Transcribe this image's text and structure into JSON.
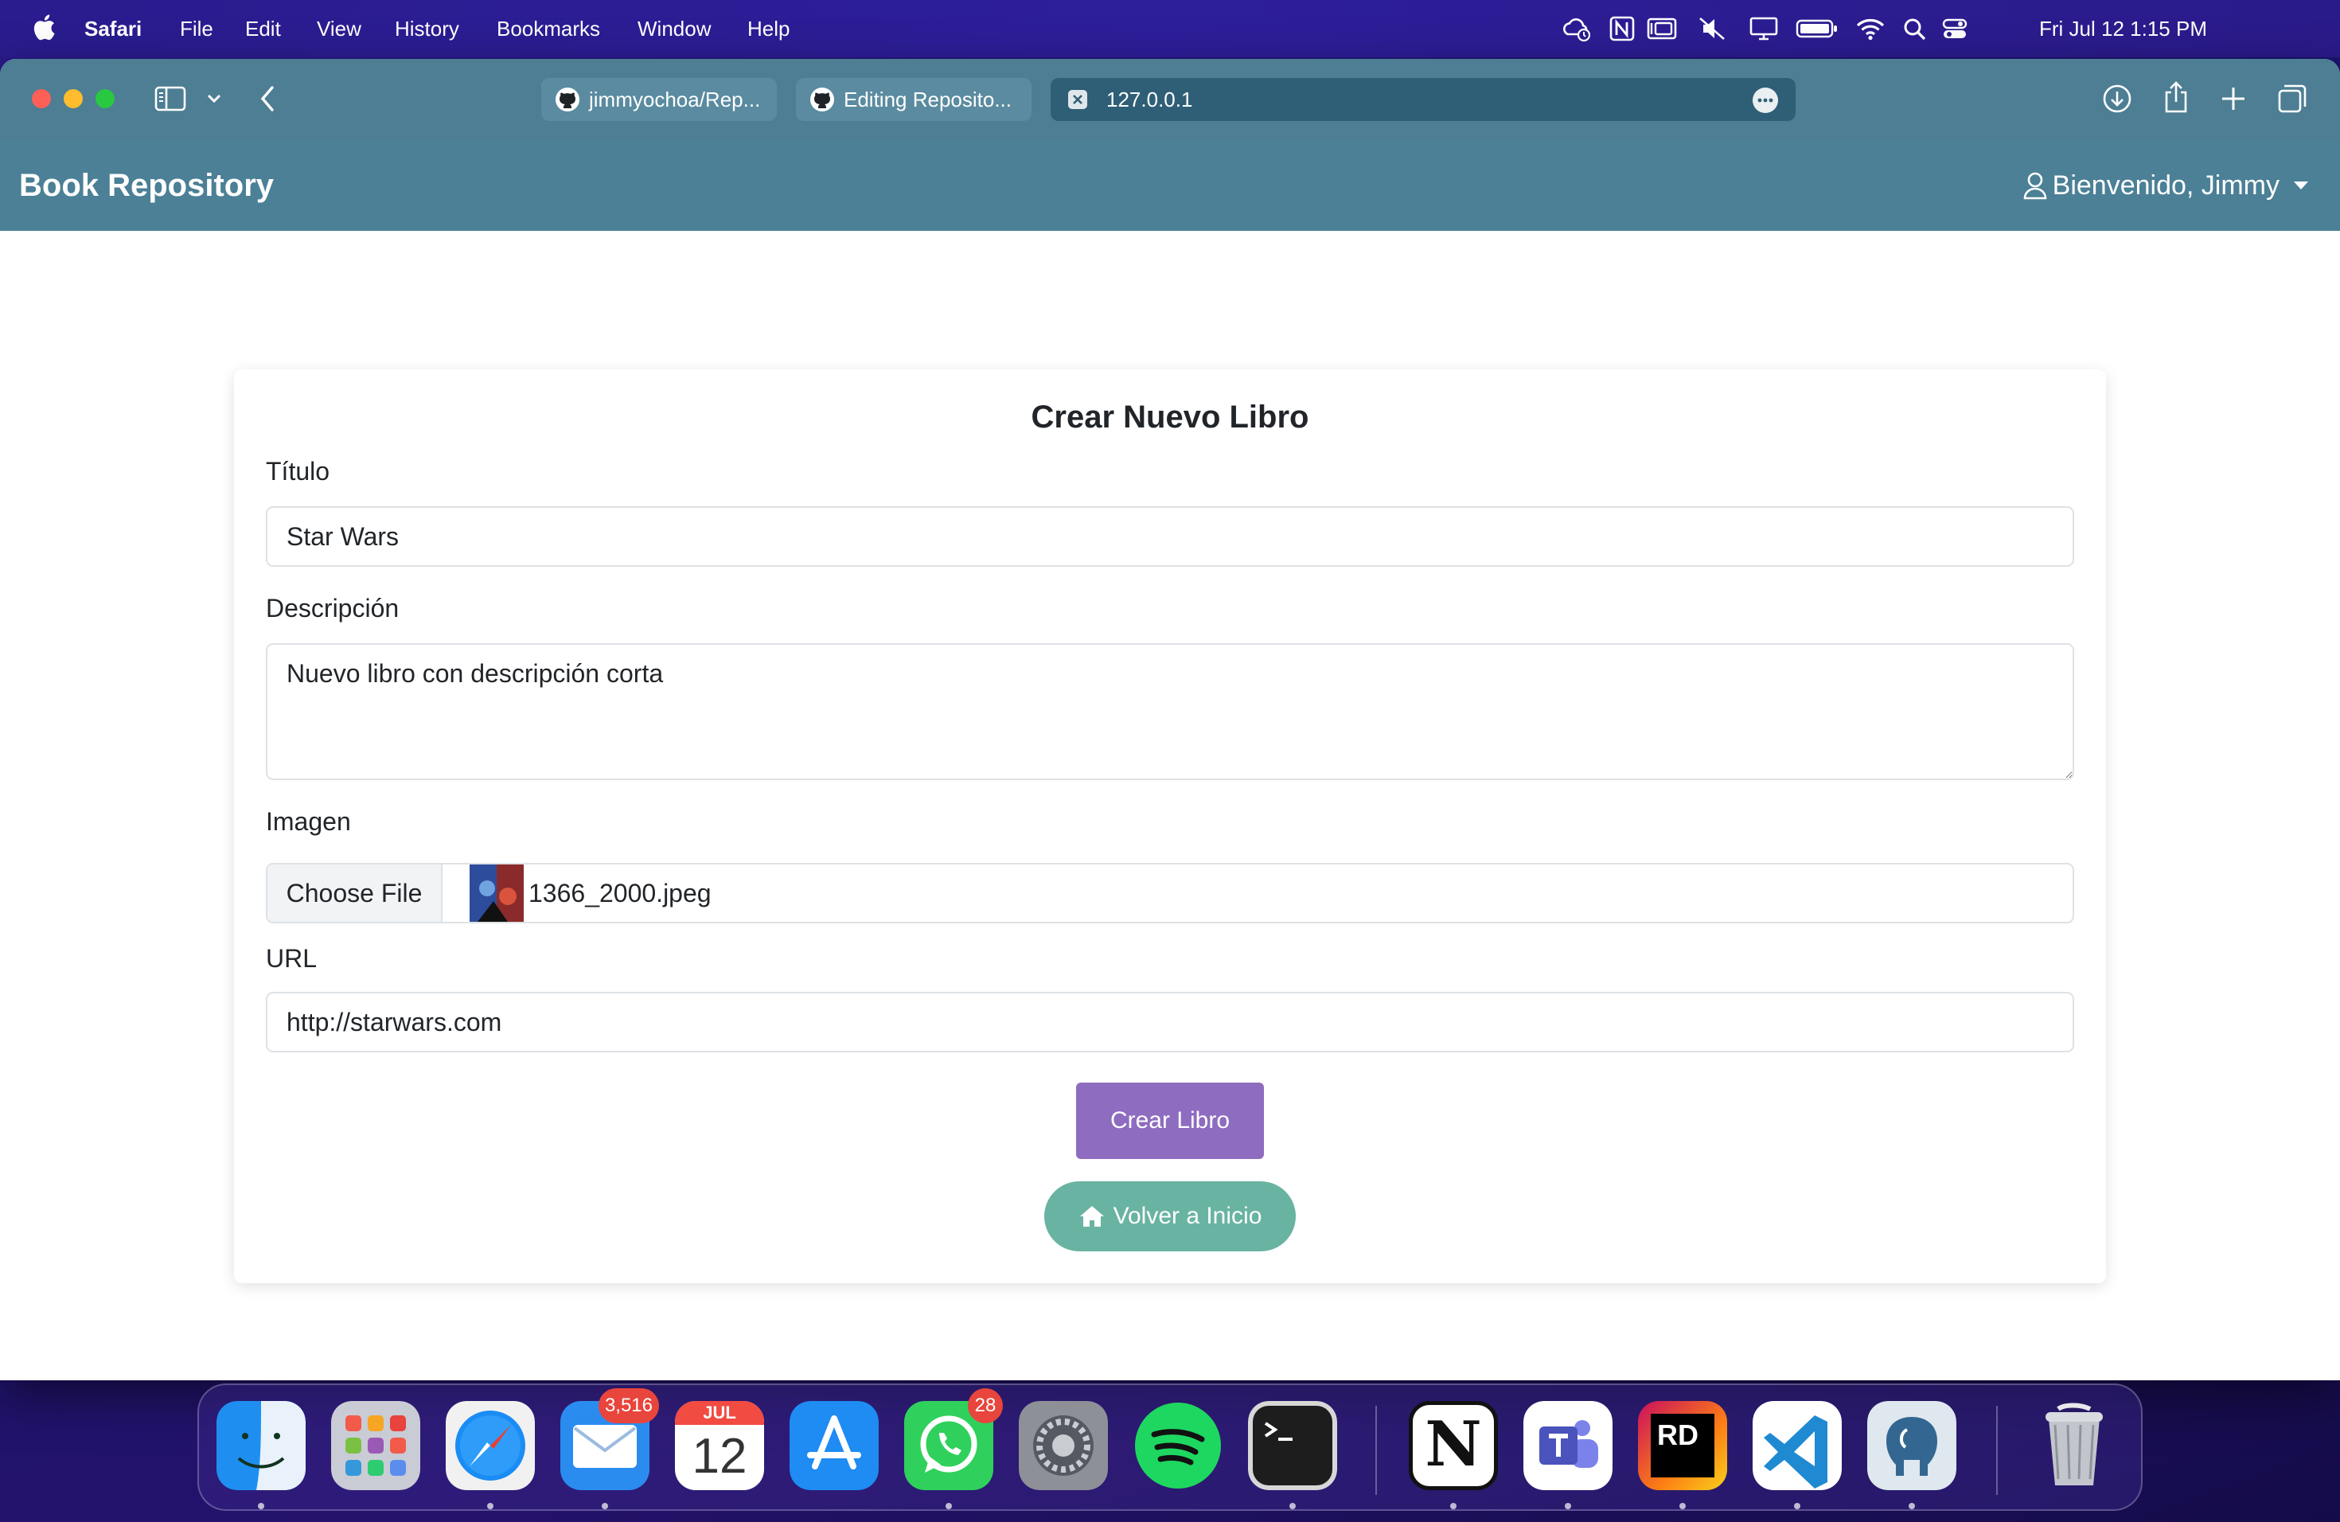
{
  "menubar": {
    "app_name": "Safari",
    "items": [
      "File",
      "Edit",
      "View",
      "History",
      "Bookmarks",
      "Window",
      "Help"
    ],
    "clock": "Fri Jul 12  1:15 PM"
  },
  "browser": {
    "tabs": [
      {
        "label": "jimmyochoa/Rep...",
        "icon": "github-icon"
      },
      {
        "label": "Editing Reposito...",
        "icon": "github-icon"
      },
      {
        "label": "127.0.0.1",
        "icon": "close-icon"
      }
    ]
  },
  "navbar": {
    "brand": "Book Repository",
    "user_greeting": "Bienvenido, Jimmy"
  },
  "form": {
    "title": "Crear Nuevo Libro",
    "title_label": "Título",
    "title_value": "Star Wars",
    "description_label": "Descripción",
    "description_value": "Nuevo libro con descripción corta",
    "image_label": "Imagen",
    "choose_file_label": "Choose File",
    "file_name": "1366_2000.jpeg",
    "url_label": "URL",
    "url_value": "http://starwars.com",
    "submit_label": "Crear Libro",
    "back_label": "Volver a Inicio"
  },
  "dock": {
    "apps": [
      {
        "name": "finder",
        "badge": ""
      },
      {
        "name": "launchpad",
        "badge": ""
      },
      {
        "name": "safari",
        "badge": ""
      },
      {
        "name": "mail",
        "badge": "3,516"
      },
      {
        "name": "calendar",
        "badge": ""
      },
      {
        "name": "app-store",
        "badge": ""
      },
      {
        "name": "whatsapp",
        "badge": "28"
      },
      {
        "name": "system-settings",
        "badge": ""
      },
      {
        "name": "spotify",
        "badge": ""
      },
      {
        "name": "terminal",
        "badge": ""
      },
      {
        "name": "notion",
        "badge": ""
      },
      {
        "name": "teams",
        "badge": ""
      },
      {
        "name": "rider",
        "badge": ""
      },
      {
        "name": "vscode",
        "badge": ""
      },
      {
        "name": "pgadmin",
        "badge": ""
      },
      {
        "name": "trash",
        "badge": ""
      }
    ],
    "calendar_month": "JUL",
    "calendar_day": "12",
    "rider_label": "RD",
    "notion_label": "N"
  }
}
